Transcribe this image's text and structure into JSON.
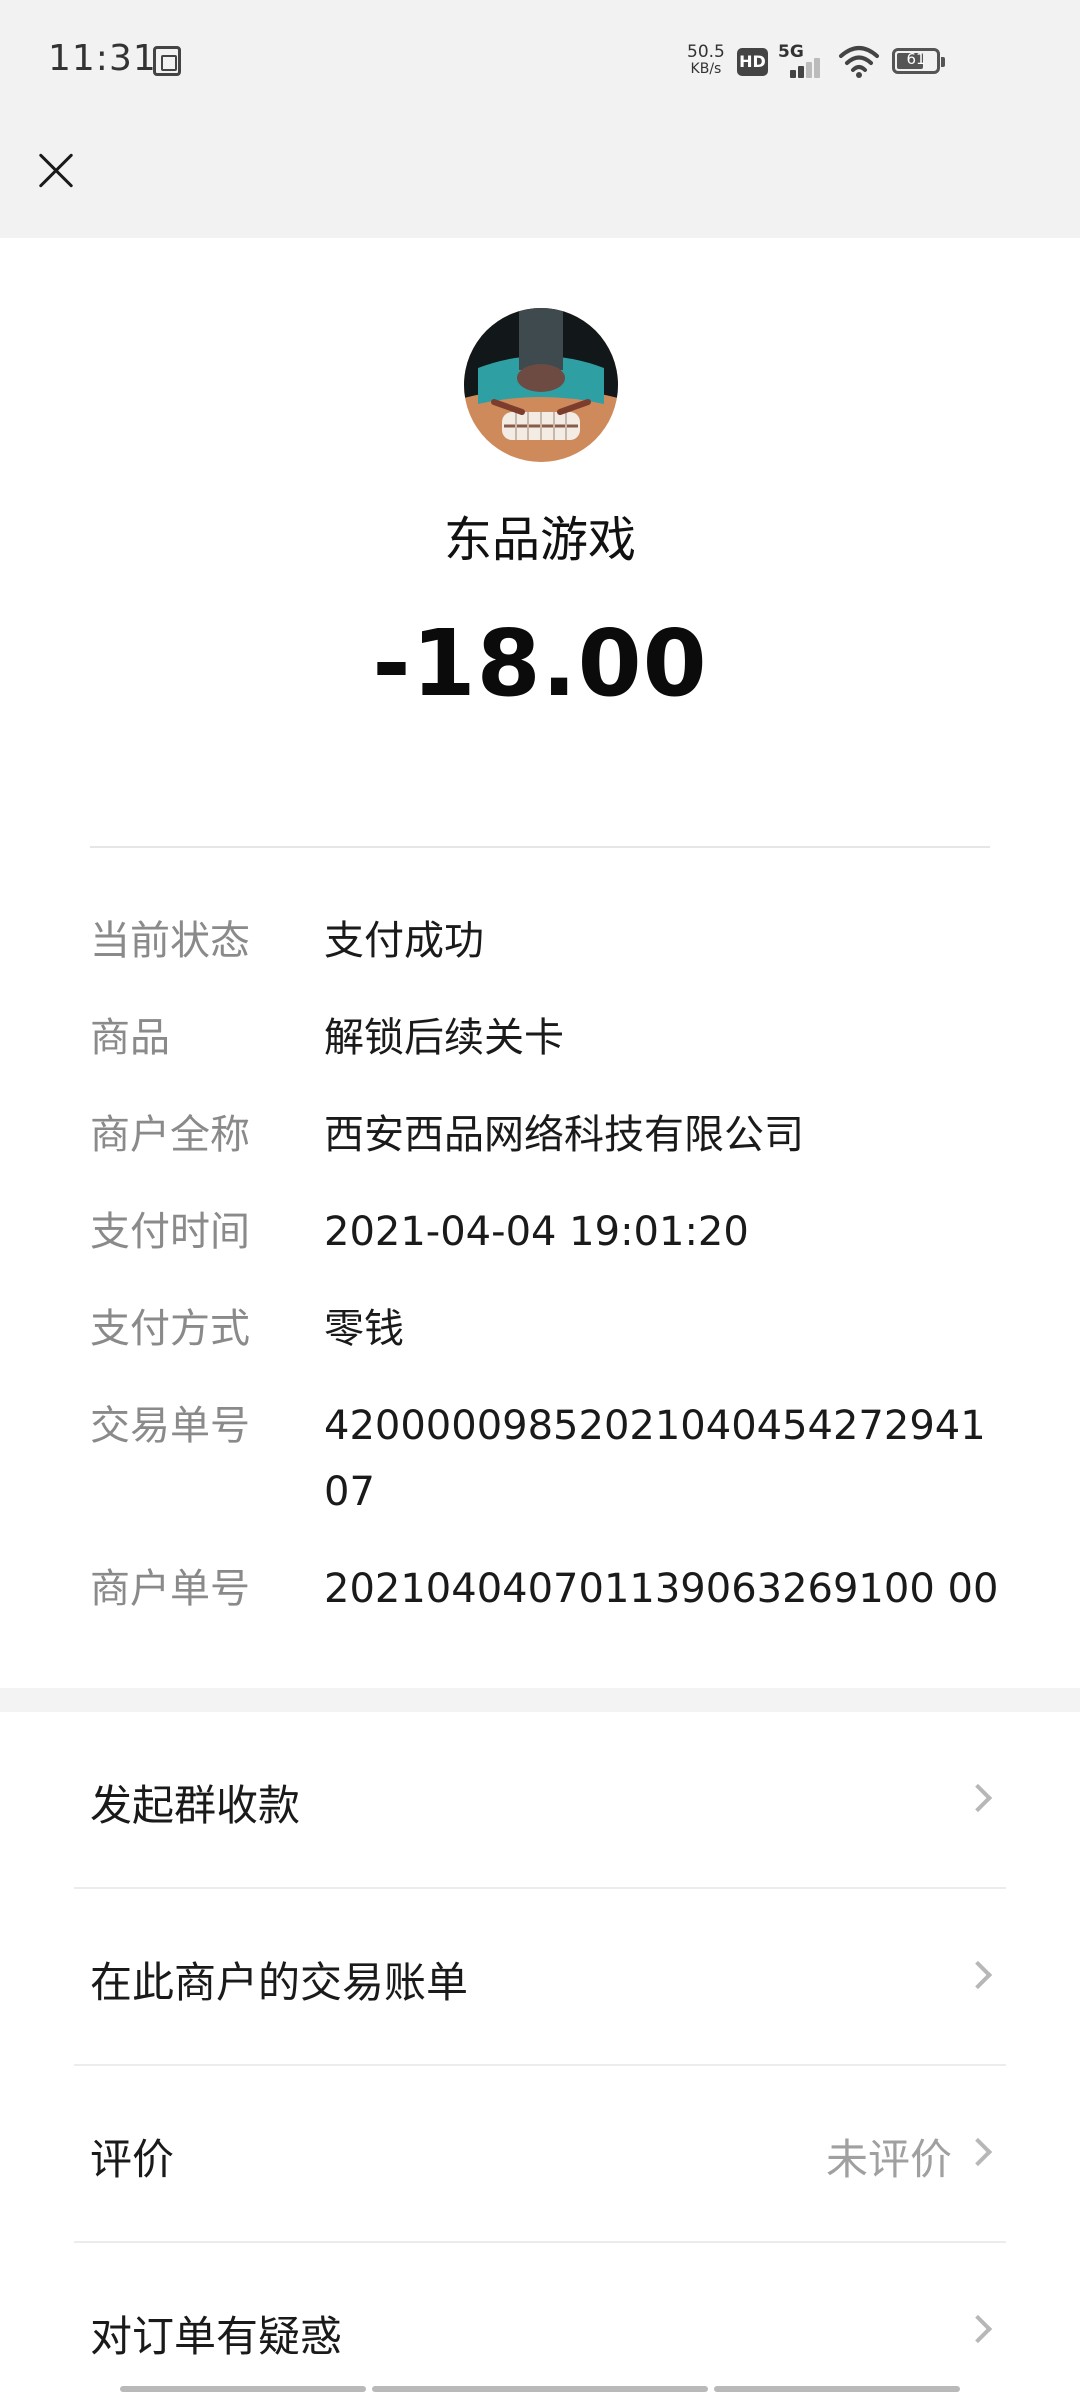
{
  "status_bar": {
    "time": "11:31",
    "net_speed_value": "50.5",
    "net_speed_unit": "KB/s",
    "hd_label": "HD",
    "network_label": "5G",
    "battery_level": "61"
  },
  "header": {
    "close_icon": "close-icon"
  },
  "merchant": {
    "name": "东品游戏",
    "amount": "-18.00"
  },
  "details": [
    {
      "label": "当前状态",
      "value": "支付成功"
    },
    {
      "label": "商品",
      "value": "解锁后续关卡"
    },
    {
      "label": "商户全称",
      "value": "西安西品网络科技有限公司"
    },
    {
      "label": "支付时间",
      "value": "2021-04-04 19:01:20"
    },
    {
      "label": "支付方式",
      "value": "零钱"
    },
    {
      "label": "交易单号",
      "value": "42000009852021040454272941 07"
    },
    {
      "label": "商户单号",
      "value": "202104040701139063269100 00"
    }
  ],
  "menu": [
    {
      "label": "发起群收款",
      "extra": ""
    },
    {
      "label": "在此商户的交易账单",
      "extra": ""
    },
    {
      "label": "评价",
      "extra": "未评价"
    },
    {
      "label": "对订单有疑惑",
      "extra": ""
    }
  ]
}
